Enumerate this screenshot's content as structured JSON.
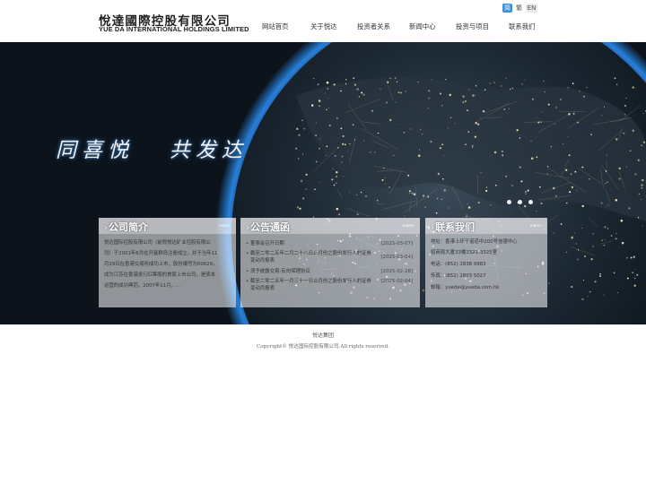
{
  "brand": {
    "name_cn": "悅達國際控股有限公司",
    "name_en": "YUE DA INTERNATIONAL HOLDINGS LIMITED"
  },
  "lang": {
    "sc": "简",
    "tc": "繁",
    "en": "EN"
  },
  "nav": {
    "items": [
      "网站首页",
      "关于悦达",
      "投资者关系",
      "新闻中心",
      "投资与项目",
      "联系我们"
    ]
  },
  "banner": {
    "slogan": "同喜悦   共发达"
  },
  "panels": {
    "profile": {
      "title": "公司简介",
      "more": "more+",
      "lines": [
        "悦达国际控股有限公司（前称悦达矿业控股有限公",
        "司）于2001年6月在开曼群岛注册成立，并于当年11",
        "月29日在香港交易所成功上市，股份编号为00629，",
        "成为江苏在香港发行红筹股的首家上市公司，是资本",
        "运营的成功典范。2007年11月，..."
      ]
    },
    "notice": {
      "title": "公告通函",
      "more": "more+",
      "items": [
        {
          "title": "董事会召开日期",
          "date": "[2025-03-07]"
        },
        {
          "title": "截至二零二五年二月二十八日止月份之股份发行人的证券变动月报表",
          "date": "[2025-03-04]"
        },
        {
          "title": "须予披露交易-反向保理协议",
          "date": "[2025-02-28]"
        },
        {
          "title": "截至二零二五年一月三十一日止月份之股份发行人的证券变动月报表",
          "date": "[2025-02-04]"
        }
      ]
    },
    "contact": {
      "title": "联系我们",
      "more": "more+",
      "lines": [
        "地址：香港上环干诺道中200号信德中心",
        "招商局大厦33楼3321-3325室",
        "电话：(852) 2838 9983",
        "传真：(852) 2893 5027",
        "邮箱：yueda@yueda.com.hk"
      ]
    }
  },
  "footer": {
    "line1": "悦达集团",
    "line2": "Copyright© 悦达国际控股有限公司.All rights reserved."
  },
  "colors": {
    "lang_active": "#3a8fd8",
    "banner_dark": "#0c131b",
    "panel_overlay": "#c8ccd0"
  }
}
